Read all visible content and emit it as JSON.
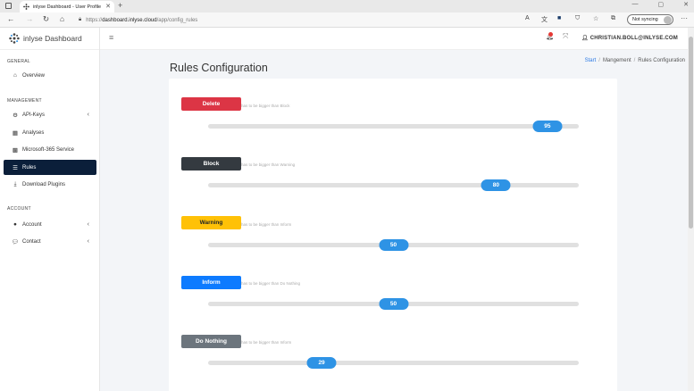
{
  "browser": {
    "tab_title": "inlyse Dashboard - User Profile",
    "url_prefix": "https://",
    "url_host": "dashboard.inlyse.cloud",
    "url_path": "/app/config_rules",
    "sync_label": "Not syncing"
  },
  "brand": {
    "name": "inlyse Dashboard"
  },
  "header": {
    "user": "CHRISTIAN.BOLL@INLYSE.COM"
  },
  "sidebar": {
    "general_title": "GENERAL",
    "management_title": "MANAGEMENT",
    "account_title": "ACCOUNT",
    "items": [
      {
        "label": "Overview"
      },
      {
        "label": "API-Keys"
      },
      {
        "label": "Analyses"
      },
      {
        "label": "Microsoft-365 Service"
      },
      {
        "label": "Rules"
      },
      {
        "label": "Download Plugins"
      },
      {
        "label": "Account"
      },
      {
        "label": "Contact"
      }
    ]
  },
  "page": {
    "title": "Rules Configuration",
    "breadcrumb": {
      "start": "Start",
      "middle": "Mangement",
      "current": "Rules Configuration"
    }
  },
  "rules": [
    {
      "label": "Delete",
      "hint": "has to be bigger than Block",
      "value": 95,
      "color": "#dc3545",
      "text_color": "#ffffff"
    },
    {
      "label": "Block",
      "hint": "has to be bigger than Warning",
      "value": 80,
      "color": "#343a40",
      "text_color": "#ffffff"
    },
    {
      "label": "Warning",
      "hint": "has to be bigger than Inform",
      "value": 50,
      "color": "#ffc107",
      "text_color": "#212529"
    },
    {
      "label": "Inform",
      "hint": "has to be bigger than Do Nothing",
      "value": 50,
      "color": "#0d7bff",
      "text_color": "#ffffff"
    },
    {
      "label": "Do Nothing",
      "hint": "has to be bigger than Inform",
      "value": 29,
      "color": "#6c757d",
      "text_color": "#ffffff"
    }
  ],
  "colors": {
    "accent": "#2e93e5",
    "active_nav": "#0b1f3a"
  }
}
